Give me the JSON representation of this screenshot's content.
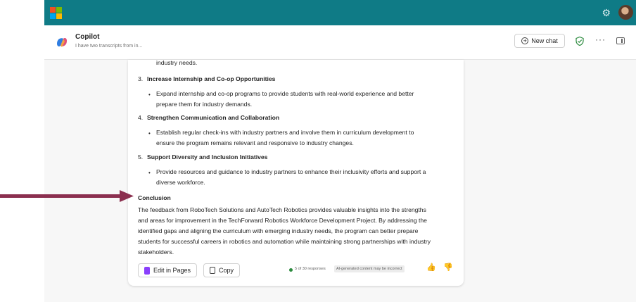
{
  "app": {
    "title": "Copilot",
    "subtitle": "I have two transcripts from in..."
  },
  "header": {
    "new_chat_label": "New chat",
    "more_label": "···"
  },
  "topbar": {
    "gear_glyph": "⚙"
  },
  "colors": {
    "topbar": "#0f7b86",
    "arrow": "#8b2f4f",
    "ms_red": "#f25022",
    "ms_green": "#7fba00",
    "ms_blue": "#00a4ef",
    "ms_yellow": "#ffb900"
  },
  "message": {
    "prev_tail": "industry needs.",
    "items": [
      {
        "num": "3.",
        "heading": "Increase Internship and Co-op Opportunities",
        "bullet": [
          "Expand internship and co-op programs to provide students with real-world experience and better",
          "prepare them for industry demands."
        ]
      },
      {
        "num": "4.",
        "heading": "Strengthen Communication and Collaboration",
        "bullet": [
          "Establish regular check-ins with industry partners and involve them in curriculum development to",
          "ensure the program remains relevant and responsive to industry changes."
        ]
      },
      {
        "num": "5.",
        "heading": "Support Diversity and Inclusion Initiatives",
        "bullet": [
          "Provide resources and guidance to industry partners to enhance their inclusivity efforts and support a",
          "diverse workforce."
        ]
      }
    ],
    "conclusion_heading": "Conclusion",
    "conclusion_lines": [
      "The feedback from RoboTech Solutions and AutoTech Robotics provides valuable insights into the strengths",
      "and areas for improvement in the TechForward Robotics Workforce Development Project. By addressing the",
      "identified gaps and aligning the curriculum with emerging industry needs, the program can better prepare",
      "students for successful careers in robotics and automation while maintaining strong partnerships with industry",
      "stakeholders."
    ]
  },
  "footer": {
    "edit_in_pages": "Edit in Pages",
    "copy": "Copy",
    "responses": "5 of 30 responses",
    "ai_notice": "AI-generated content may be incorrect",
    "thumbs_up": "👍",
    "thumbs_down": "👎"
  }
}
